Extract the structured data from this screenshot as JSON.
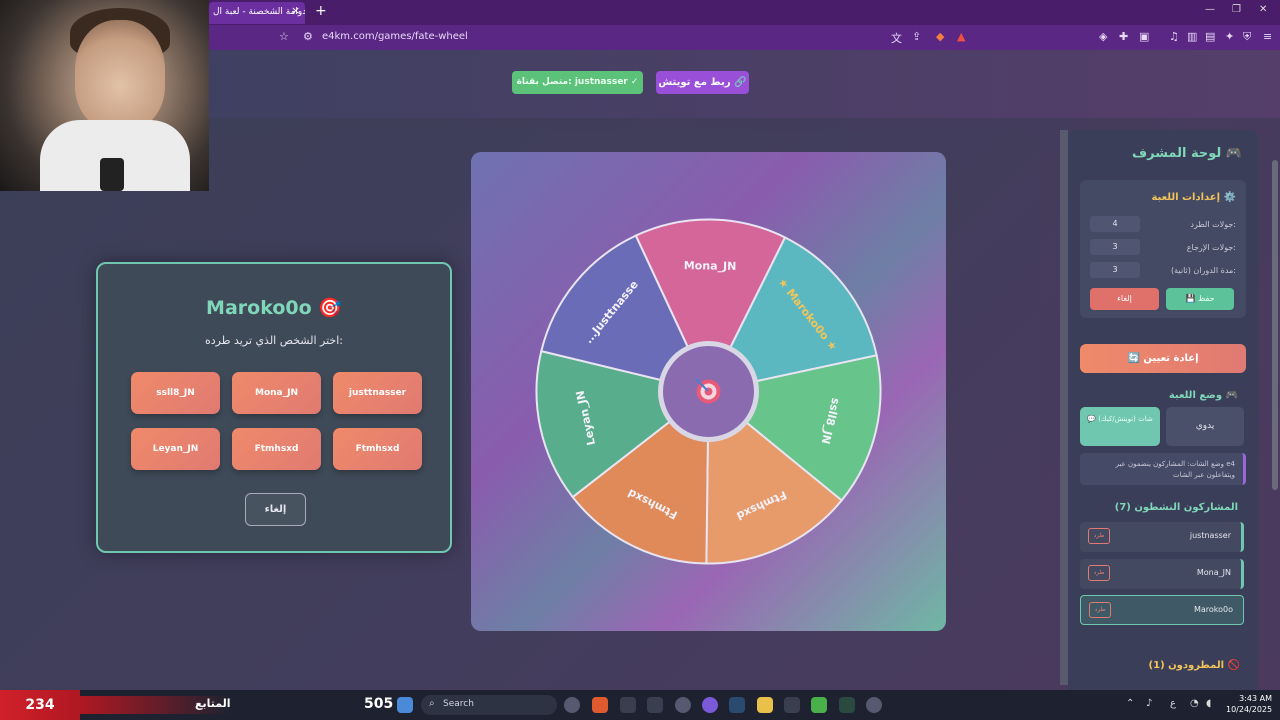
{
  "browser": {
    "tab_title": "دوامة الشخصنة - لعبة ال",
    "url": "e4km.com/games/fate-wheel",
    "tab_close": "×",
    "tab_new": "+"
  },
  "header": {
    "connected_label": "متصل بقناة: justnasser ✓",
    "twitch_label": "ربط مع تويتش 🔗"
  },
  "modal": {
    "title": "Maroko0o 🎯",
    "subtitle": "اختر الشخص الذي تريد طرده:",
    "choices": [
      "ssll8_JN",
      "Mona_JN",
      "justtnasser",
      "Leyan_JN",
      "Ftmhsxd",
      "Ftmhsxd"
    ],
    "cancel_label": "إلغاء"
  },
  "wheel": {
    "segments": [
      {
        "label": "Mona_JN",
        "color": "#d4669a"
      },
      {
        "label": "★ Maroko0o ★",
        "color": "#5cb8c0"
      },
      {
        "label": "ssll8_JN",
        "color": "#67c48a"
      },
      {
        "label": "Ftmhsxd",
        "color": "#e79a6a"
      },
      {
        "label": "Ftmhsxd",
        "color": "#df8a58"
      },
      {
        "label": "Leyan_JN",
        "color": "#58ae8c"
      },
      {
        "label": "...Justtnasse",
        "color": "#6b6cb8"
      }
    ],
    "center_icon": "target-icon"
  },
  "sidebar": {
    "title": "لوحة المشرف 🎮",
    "settings_title": "إعدادات اللعبة ⚙️",
    "settings": [
      {
        "label": "جولات الطرد:",
        "value": "4"
      },
      {
        "label": "جولات الإرجاع:",
        "value": "3"
      },
      {
        "label": "مدة الدوران (ثانية):",
        "value": "3"
      }
    ],
    "save_label": "💾 حفظ",
    "cancel_label": "إلغاء",
    "reset_label": "🔄 إعادة تعيين",
    "mode_title": "وضع اللعبة 🎮",
    "mode_chat": "💬 شات (تويتش/كيك)",
    "mode_manual": "يدوي",
    "mode_desc": "وضع الشات: المشاركون ينضمون عبر e4 ويتفاعلون عبر الشات",
    "active_title": "المشاركون النشطون (7)",
    "players": [
      {
        "name": "justnasser",
        "kick": "طرد"
      },
      {
        "name": "Mona_JN",
        "kick": "طرد"
      },
      {
        "name": "Maroko0o",
        "kick": "طرد"
      }
    ],
    "kicked_title": "المطرودون (1) 🚫"
  },
  "taskbar": {
    "count": "234",
    "follower_label": "المتابع",
    "score": "505",
    "search_placeholder": "Search",
    "time": "3:43 AM",
    "date": "10/24/2025",
    "lang": "ع"
  }
}
